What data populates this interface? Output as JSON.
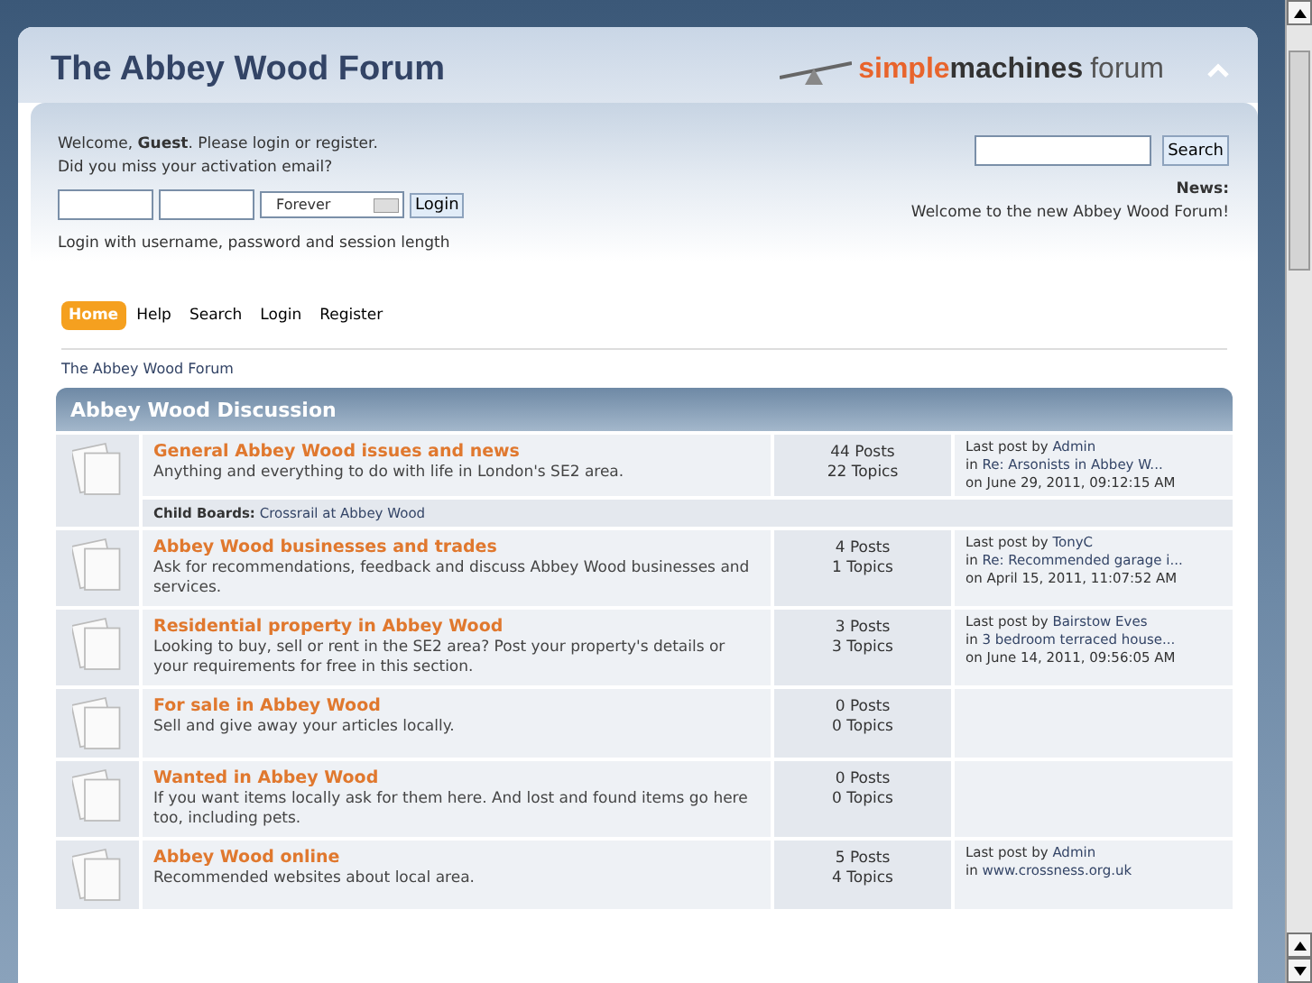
{
  "header": {
    "title": "The Abbey Wood Forum",
    "logo": {
      "accent": "simple",
      "main": "machines",
      "suffix": "forum"
    }
  },
  "user_box": {
    "welcome": "Welcome, **Guest**. Please login or register.",
    "activation": "Did you miss your activation email?",
    "session_select": "Forever",
    "login_button": "Login",
    "hint": "Login with username, password and session length"
  },
  "search": {
    "button": "Search"
  },
  "news": {
    "label": "News:",
    "text": "Welcome to the new Abbey Wood Forum!"
  },
  "menu": [
    {
      "label": "Home",
      "selected": true
    },
    {
      "label": "Help",
      "selected": false
    },
    {
      "label": "Search",
      "selected": false
    },
    {
      "label": "Login",
      "selected": false
    },
    {
      "label": "Register",
      "selected": false
    }
  ],
  "breadcrumb": "The Abbey Wood Forum",
  "category": {
    "title": "Abbey Wood Discussion",
    "boards": [
      {
        "name": "General Abbey Wood issues and news",
        "description": "Anything and everything to do with life in London's SE2 area.",
        "posts": "44 Posts",
        "topics": "22 Topics",
        "last_post": {
          "label": "Last post by",
          "user": "Admin",
          "in": "in",
          "topic": "Re: Arsonists in Abbey W...",
          "date": "on June 29, 2011, 09:12:15 AM"
        },
        "child_label": "Child Boards:",
        "child_boards": [
          "Crossrail at Abbey Wood"
        ]
      },
      {
        "name": "Abbey Wood businesses and trades",
        "description": "Ask for recommendations, feedback and discuss Abbey Wood businesses and services.",
        "posts": "4 Posts",
        "topics": "1 Topics",
        "last_post": {
          "label": "Last post by",
          "user": "TonyC",
          "in": "in",
          "topic": "Re: Recommended garage i...",
          "date": "on April 15, 2011, 11:07:52 AM"
        }
      },
      {
        "name": "Residential property in Abbey Wood",
        "description": "Looking to buy, sell or rent in the SE2 area? Post your property's details or your requirements for free in this section.",
        "posts": "3 Posts",
        "topics": "3 Topics",
        "last_post": {
          "label": "Last post by",
          "user": "Bairstow Eves",
          "in": "in",
          "topic": "3 bedroom terraced house...",
          "date": "on June 14, 2011, 09:56:05 AM"
        }
      },
      {
        "name": "For sale in Abbey Wood",
        "description": "Sell and give away your articles locally.",
        "posts": "0 Posts",
        "topics": "0 Topics"
      },
      {
        "name": "Wanted in Abbey Wood",
        "description": "If you want items locally ask for them here. And lost and found items go here too, including pets.",
        "posts": "0 Posts",
        "topics": "0 Topics"
      },
      {
        "name": "Abbey Wood online",
        "description": "Recommended websites about local area.",
        "posts": "5 Posts",
        "topics": "4 Topics",
        "last_post": {
          "label": "Last post by",
          "user": "Admin",
          "in": "in",
          "topic": "www.crossness.org.uk"
        }
      }
    ]
  }
}
